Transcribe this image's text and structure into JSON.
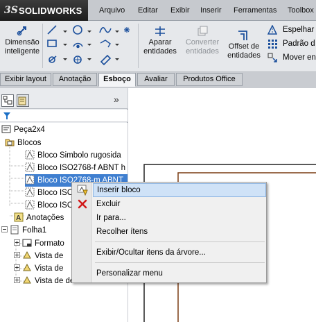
{
  "app": {
    "logo_mark": "3S",
    "logo_text": "SOLIDWORKS"
  },
  "menubar": [
    "Arquivo",
    "Editar",
    "Exibir",
    "Inserir",
    "Ferramentas",
    "Toolbox"
  ],
  "ribbon": {
    "smart_dimension": [
      "Dimensão",
      "inteligente"
    ],
    "trim": [
      "Aparar",
      "entidades"
    ],
    "convert": [
      "Converter",
      "entidades"
    ],
    "offset": [
      "Offset de",
      "entidades"
    ],
    "mirror": "Espelhar",
    "pattern": "Padrão d",
    "move": "Mover en"
  },
  "tabs": [
    "Exibir layout",
    "Anotação",
    "Esboço",
    "Avaliar",
    "Produtos Office"
  ],
  "active_tab": "Esboço",
  "panel": {
    "collapse_glyph": "»",
    "tree": [
      {
        "label": "Peça2x4",
        "indent": 0,
        "icon": "part-icon"
      },
      {
        "label": "Blocos",
        "indent": 1,
        "icon": "folder-icon"
      },
      {
        "label": "Bloco Simbolo rugosida",
        "indent": 2,
        "icon": "block-icon"
      },
      {
        "label": "Bloco ISO2768-f ABNT h",
        "indent": 2,
        "icon": "block-icon"
      },
      {
        "label": "Bloco ISO2768-m ABNT",
        "indent": 2,
        "icon": "block-icon",
        "selected": true
      },
      {
        "label": "Bloco ISO",
        "indent": 2,
        "icon": "block-icon"
      },
      {
        "label": "Bloco ISO",
        "indent": 2,
        "icon": "block-icon"
      },
      {
        "label": "Anotações",
        "indent": 1,
        "icon": "annotation-icon"
      },
      {
        "label": "Folha1",
        "indent": 1,
        "icon": "sheet-icon"
      },
      {
        "label": "Formato",
        "indent": 2,
        "icon": "format-icon"
      },
      {
        "label": "Vista de",
        "indent": 2,
        "icon": "view-icon"
      },
      {
        "label": "Vista de",
        "indent": 2,
        "icon": "view-icon"
      },
      {
        "label": "Vista de desenhos",
        "indent": 2,
        "icon": "view-icon"
      }
    ]
  },
  "context_menu": {
    "items": [
      "Inserir bloco",
      "Excluir",
      "Ir para...",
      "Recolher ítens",
      "Exibir/Ocultar itens da árvore...",
      "Personalizar menu"
    ]
  },
  "colors": {
    "selection": "#3f7fd0",
    "drawing_border": "#7a3b12",
    "delete_x": "#d11a1a"
  }
}
